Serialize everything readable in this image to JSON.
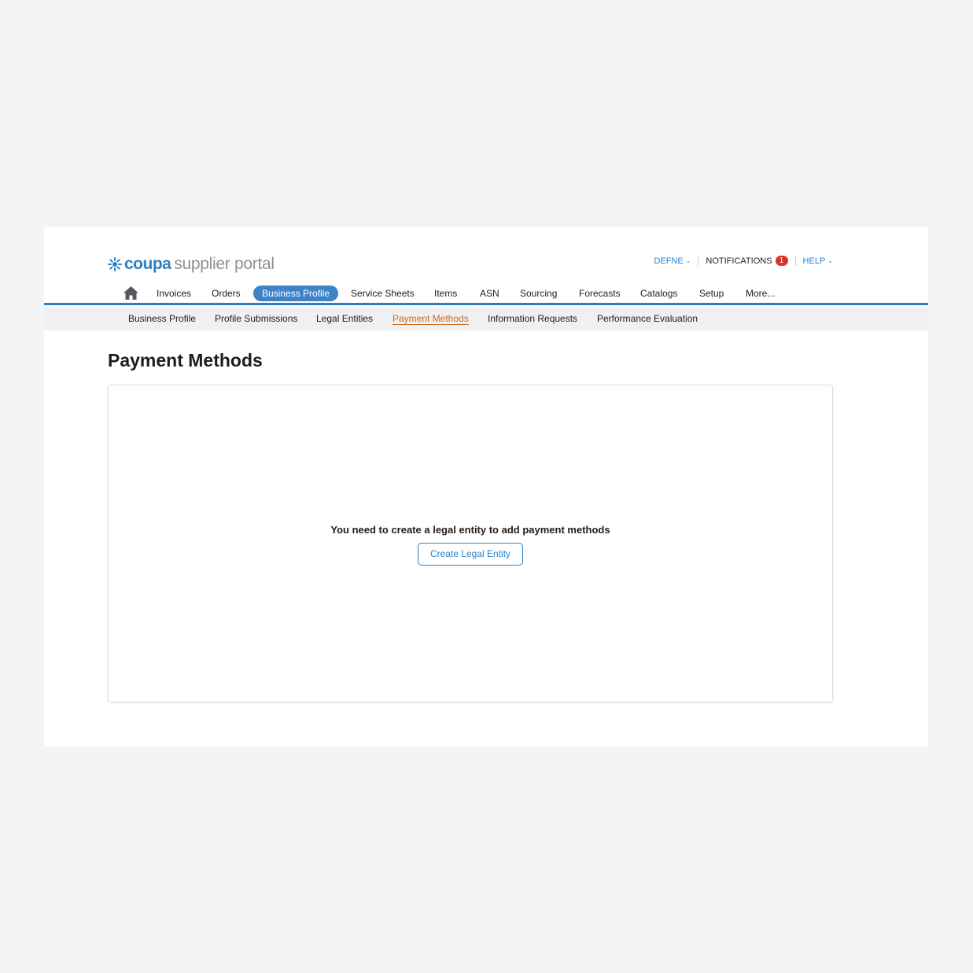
{
  "header": {
    "logo_brand": "coupa",
    "logo_product": "supplier portal",
    "user_label": "DEFNE",
    "notifications_label": "NOTIFICATIONS",
    "notifications_count": "1",
    "help_label": "HELP"
  },
  "main_nav": {
    "items": [
      {
        "label": "Invoices"
      },
      {
        "label": "Orders"
      },
      {
        "label": "Business Profile",
        "active": true
      },
      {
        "label": "Service Sheets"
      },
      {
        "label": "Items"
      },
      {
        "label": "ASN"
      },
      {
        "label": "Sourcing"
      },
      {
        "label": "Forecasts"
      },
      {
        "label": "Catalogs"
      },
      {
        "label": "Setup"
      },
      {
        "label": "More..."
      }
    ]
  },
  "sub_nav": {
    "items": [
      {
        "label": "Business Profile"
      },
      {
        "label": "Profile Submissions"
      },
      {
        "label": "Legal Entities"
      },
      {
        "label": "Payment Methods",
        "active": true
      },
      {
        "label": "Information Requests"
      },
      {
        "label": "Performance Evaluation"
      }
    ]
  },
  "page": {
    "title": "Payment Methods",
    "empty_message": "You need to create a legal entity to add payment methods",
    "create_button_label": "Create Legal Entity"
  },
  "colors": {
    "accent": "#2e7fc2",
    "active_subnav": "#d1681a",
    "badge": "#d9342b"
  }
}
